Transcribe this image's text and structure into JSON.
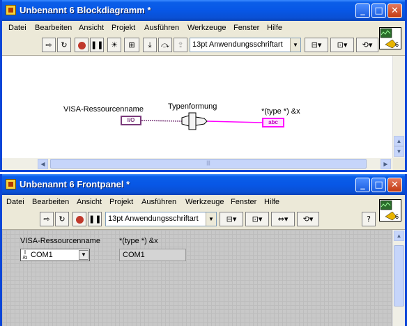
{
  "block_diagram": {
    "title": "Unbenannt 6 Blockdiagramm *",
    "menu": [
      "Datei",
      "Bearbeiten",
      "Ansicht",
      "Projekt",
      "Ausführen",
      "Werkzeuge",
      "Fenster",
      "Hilfe"
    ],
    "font_selector": "13pt Anwendungsschriftart",
    "visa_label": "VISA-Ressourcenname",
    "visa_terminal": "I/O",
    "cast_label": "Typenformung",
    "output_label": "*(type *) &x",
    "output_terminal": "abc",
    "icon_number": "6"
  },
  "front_panel": {
    "title": "Unbenannt 6 Frontpanel *",
    "menu": [
      "Datei",
      "Bearbeiten",
      "Ansicht",
      "Projekt",
      "Ausführen",
      "Werkzeuge",
      "Fenster",
      "Hilfe"
    ],
    "font_selector": "13pt Anwendungsschriftart",
    "visa_label": "VISA-Ressourcenname",
    "visa_value": "COM1",
    "output_label": "*(type *) &x",
    "output_value": "COM1",
    "icon_number": "6",
    "help_button": "?"
  },
  "window_buttons": {
    "minimize": "_",
    "maximize": "□",
    "close": "✕"
  },
  "colors": {
    "titlebar": "#0757e6",
    "wire_string": "#ff00ff",
    "wire_visa": "#7a3a7a",
    "panel_background": "#c8c8c8"
  }
}
